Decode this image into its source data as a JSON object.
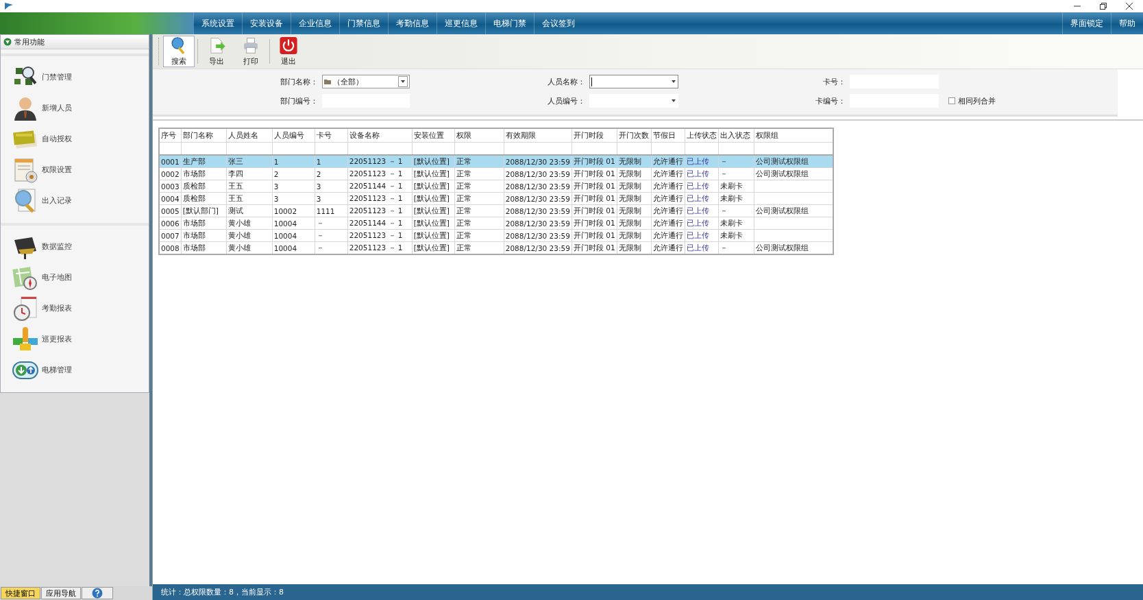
{
  "window": {
    "controls": [
      {
        "kind": "minimize"
      },
      {
        "kind": "restore"
      },
      {
        "kind": "close"
      }
    ]
  },
  "menu": {
    "items": [
      "系统设置",
      "安装设备",
      "企业信息",
      "门禁信息",
      "考勤信息",
      "巡更信息",
      "电梯门禁",
      "会议签到"
    ],
    "right_items": [
      "界面锁定",
      "帮助"
    ]
  },
  "sidebar": {
    "title": "常用功能",
    "expanded": true,
    "groups": [
      [
        {
          "label": "门禁管理",
          "kind": "access"
        },
        {
          "label": "新增人员",
          "kind": "person"
        },
        {
          "label": "自动授权",
          "kind": "card"
        },
        {
          "label": "权限设置",
          "kind": "permission"
        },
        {
          "label": "出入记录",
          "kind": "record"
        }
      ],
      [
        {
          "label": "数据监控",
          "kind": "monitor"
        },
        {
          "label": "电子地图",
          "kind": "map"
        },
        {
          "label": "考勤报表",
          "kind": "attendance"
        },
        {
          "label": "巡更报表",
          "kind": "patrol"
        },
        {
          "label": "电梯管理",
          "kind": "elevator"
        }
      ]
    ]
  },
  "toolbar": [
    {
      "label": "搜索",
      "kind": "search",
      "selected": true
    },
    {
      "label": "导出",
      "kind": "export",
      "selected": false
    },
    {
      "label": "打印",
      "kind": "print",
      "selected": false
    },
    {
      "label": "退出",
      "kind": "exit",
      "selected": false
    }
  ],
  "filters": [
    {
      "label": "部门名称：",
      "kind": "tree-combo",
      "value": "（全部）"
    },
    {
      "label": "人员名称：",
      "kind": "combo",
      "focused": true
    },
    {
      "label": "卡号：",
      "kind": "text"
    },
    {
      "label": "部门编号：",
      "kind": "text"
    },
    {
      "label": "人员编号：",
      "kind": "combo",
      "focused": false
    },
    {
      "label": "卡编号：",
      "kind": "text"
    }
  ],
  "merge_checkbox": {
    "label": "相同列合并",
    "checked": false
  },
  "table": {
    "columns": [
      "序号",
      "部门名称",
      "人员姓名",
      "人员编号",
      "卡号",
      "设备名称",
      "安装位置",
      "权限",
      "有效期限",
      "开门时段",
      "开门次数",
      "节假日",
      "上传状态",
      "出入状态",
      "权限组"
    ],
    "rows": [
      {
        "selected": true,
        "cells": [
          "0001",
          "生产部",
          "张三",
          "1",
          "1",
          "22051123 － 1",
          "[默认位置]",
          "正常",
          "2088/12/30 23:59",
          "开门时段 01",
          "无限制",
          "允许通行",
          "已上传",
          "－",
          "公司测试权限组"
        ]
      },
      {
        "selected": false,
        "cells": [
          "0002",
          "市场部",
          "李四",
          "2",
          "2",
          "22051123 － 1",
          "[默认位置]",
          "正常",
          "2088/12/30 23:59",
          "开门时段 01",
          "无限制",
          "允许通行",
          "已上传",
          "－",
          "公司测试权限组"
        ]
      },
      {
        "selected": false,
        "cells": [
          "0003",
          "质检部",
          "王五",
          "3",
          "3",
          "22051144 － 1",
          "[默认位置]",
          "正常",
          "2088/12/30 23:59",
          "开门时段 01",
          "无限制",
          "允许通行",
          "已上传",
          "未刷卡",
          ""
        ]
      },
      {
        "selected": false,
        "cells": [
          "0004",
          "质检部",
          "王五",
          "3",
          "3",
          "22051123 － 1",
          "[默认位置]",
          "正常",
          "2088/12/30 23:59",
          "开门时段 01",
          "无限制",
          "允许通行",
          "已上传",
          "未刷卡",
          ""
        ]
      },
      {
        "selected": false,
        "cells": [
          "0005",
          "[默认部门]",
          "测试",
          "10002",
          "1111",
          "22051123 － 1",
          "[默认位置]",
          "正常",
          "2088/12/30 23:59",
          "开门时段 01",
          "无限制",
          "允许通行",
          "已上传",
          "－",
          "公司测试权限组"
        ]
      },
      {
        "selected": false,
        "cells": [
          "0006",
          "市场部",
          "黄小雄",
          "10004",
          "－",
          "22051144 － 1",
          "[默认位置]",
          "正常",
          "2088/12/30 23:59",
          "开门时段 01",
          "无限制",
          "允许通行",
          "已上传",
          "未刷卡",
          ""
        ]
      },
      {
        "selected": false,
        "cells": [
          "0007",
          "市场部",
          "黄小雄",
          "10004",
          "－",
          "22051123 － 1",
          "[默认位置]",
          "正常",
          "2088/12/30 23:59",
          "开门时段 01",
          "无限制",
          "允许通行",
          "已上传",
          "未刷卡",
          ""
        ]
      },
      {
        "selected": false,
        "cells": [
          "0008",
          "市场部",
          "黄小雄",
          "10004",
          "－",
          "22051123 － 1",
          "[默认位置]",
          "正常",
          "2088/12/30 23:59",
          "开门时段 01",
          "无限制",
          "允许通行",
          "已上传",
          "－",
          "公司测试权限组"
        ]
      }
    ]
  },
  "bottom_tabs": [
    {
      "label": "快捷窗口",
      "kind": "text",
      "selected": true
    },
    {
      "label": "应用导航",
      "kind": "text",
      "selected": false
    },
    {
      "kind": "help",
      "selected": false
    }
  ],
  "status_bar": "统计：总权限数量：8，当前显示：8"
}
